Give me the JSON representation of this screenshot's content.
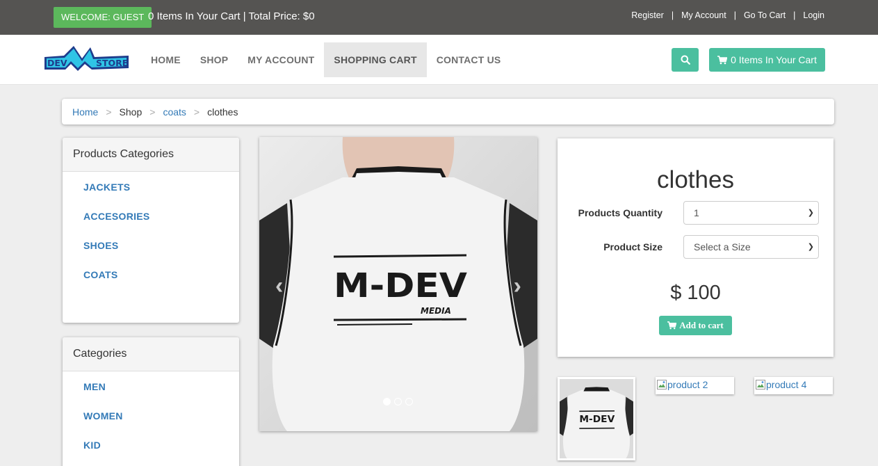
{
  "topbar": {
    "welcome": "WELCOME: GUEST",
    "cart_summary": "0 Items In Your Cart | Total Price: $0",
    "links": [
      "Register",
      "My Account",
      "Go To Cart",
      "Login"
    ]
  },
  "logo": {
    "text_left": "DEV",
    "text_right": "STORE",
    "letter": "M"
  },
  "nav": {
    "items": [
      "HOME",
      "SHOP",
      "MY ACCOUNT",
      "SHOPPING CART",
      "CONTACT US"
    ],
    "active": "SHOPPING CART",
    "cart_button": "0 Items In Your Cart"
  },
  "breadcrumb": [
    "Home",
    "Shop",
    "coats",
    "clothes"
  ],
  "sidebar": {
    "products_title": "Products Categories",
    "products": [
      "JACKETS",
      "ACCESORIES",
      "SHOES",
      "COATS"
    ],
    "categories_title": "Categories",
    "categories": [
      "MEN",
      "WOMEN",
      "KID"
    ]
  },
  "carousel": {
    "shirt_text": "M-DEV",
    "shirt_subtext": "MEDIA",
    "slides": 3,
    "active_slide": 1
  },
  "product": {
    "name": "clothes",
    "quantity_label": "Products Quantity",
    "quantity_value": "1",
    "size_label": "Product Size",
    "size_placeholder": "Select a Size",
    "price": "$ 100",
    "add_to_cart": "Add to cart"
  },
  "thumbnails": [
    "product 2",
    "product 4"
  ],
  "colors": {
    "accent": "#4bbf9f",
    "topbar": "#555452",
    "welcome": "#5cb85c",
    "link": "#337ab7"
  }
}
